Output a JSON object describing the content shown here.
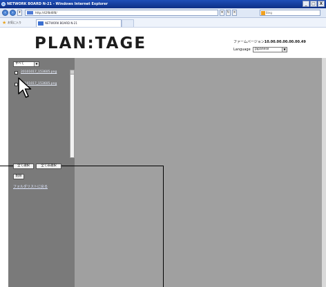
{
  "window": {
    "title": "NETWORK BOARD N-21 - Windows Internet Explorer",
    "buttons": [
      "_",
      "□",
      "X"
    ]
  },
  "addressbar": {
    "back_label": "‹",
    "forward_label": "›",
    "url": "http://42f8d6f8/",
    "search_placeholder": "Bing"
  },
  "favorites": {
    "label": "お気に入り",
    "tab_title": "NETWORK BOARD N-21"
  },
  "header": {
    "logo": "PLAN:TAGE",
    "firmware_label": "ファームバージョン",
    "firmware_value": "10.00.00.00.00.00.49",
    "language_label": "Language",
    "language_value": "Japanese"
  },
  "sidebar": {
    "filter_value": "すべて",
    "files": [
      {
        "name": "20101017_153605.png"
      },
      {
        "name": "20101017_153605.png"
      }
    ],
    "select_all_label": "全て選択",
    "deselect_all_label": "全て非選択",
    "delete_label": "削除",
    "back_link": "フォルダリストに戻る"
  },
  "colors": {
    "sidebar_bg": "#7a7a7a",
    "main_bg": "#a0a0a0",
    "link": "#dfe7ff"
  }
}
